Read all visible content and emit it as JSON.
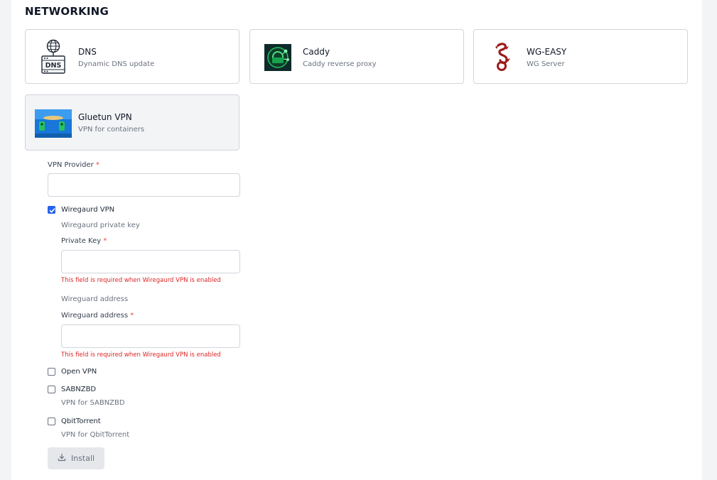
{
  "section": {
    "title": "NETWORKING"
  },
  "apps": [
    {
      "name": "DNS",
      "desc": "Dynamic DNS update",
      "icon": "dns-server-icon"
    },
    {
      "name": "Caddy",
      "desc": "Caddy reverse proxy",
      "icon": "caddy-logo-icon"
    },
    {
      "name": "WG-EASY",
      "desc": "WG Server",
      "icon": "wg-dragon-icon"
    },
    {
      "name": "Gluetun VPN",
      "desc": "VPN for containers",
      "icon": "gluetun-logo-icon"
    }
  ],
  "form": {
    "vpn_provider": {
      "label": "VPN Provider",
      "value": ""
    },
    "wireguard": {
      "label": "Wiregaurd VPN",
      "checked": true,
      "private_key_hint": "Wiregaurd private key",
      "private_key_label": "Private Key",
      "private_key_value": "",
      "private_key_error": "This field is required when Wiregaurd VPN is enabled",
      "address_hint": "Wireguard address",
      "address_label": "Wireguard address",
      "address_value": "",
      "address_error": "This field is required when Wiregaurd VPN is enabled"
    },
    "openvpn": {
      "label": "Open VPN",
      "checked": false
    },
    "sabnzbd": {
      "label": "SABNZBD",
      "checked": false,
      "hint": "VPN for SABNZBD"
    },
    "qbittorrent": {
      "label": "QbitTorrent",
      "checked": false,
      "hint": "VPN for QbitTorrent"
    },
    "required_mark": "*"
  },
  "install": {
    "label": "Install",
    "icon": "download-icon"
  },
  "colors": {
    "accent": "#2563eb",
    "error": "#dc2626",
    "required": "#ef4444"
  }
}
